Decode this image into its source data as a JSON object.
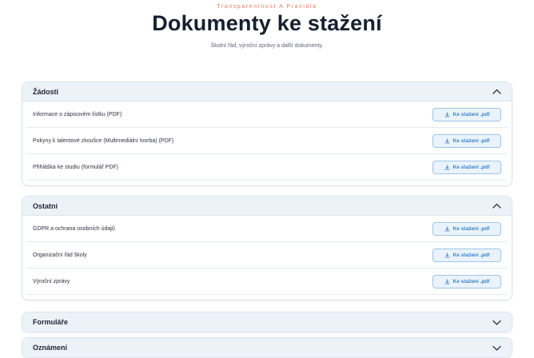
{
  "header": {
    "eyebrow": "Transparentnost A Pravidla",
    "title": "Dokumenty ke stažení",
    "subtitle": "Školní řád, výroční zprávy a další dokumenty."
  },
  "download_label": "Ke stažení .pdf",
  "icons": {
    "expanded": "chevron-up-icon",
    "collapsed": "chevron-down-icon",
    "download": "download-icon"
  },
  "colors": {
    "accent": "#3b82c9",
    "eyebrow": "#e97b5a",
    "header_bg": "#ecf3f8"
  },
  "sections": [
    {
      "title": "Žádosti",
      "expanded": true,
      "items": [
        "Informace o zápisovém lístku (PDF)",
        "Pokyny k talentové zkoušce (Multimediální tvorba) (PDF)",
        "Přihláška ke studiu (formulář PDF)"
      ]
    },
    {
      "title": "Ostatní",
      "expanded": true,
      "items": [
        "GDPR a ochrana osobních údajů",
        "Organizační řád školy",
        "Výroční zprávy"
      ]
    },
    {
      "title": "Formuláře",
      "expanded": false,
      "items": []
    },
    {
      "title": "Oznámení",
      "expanded": false,
      "items": []
    }
  ]
}
